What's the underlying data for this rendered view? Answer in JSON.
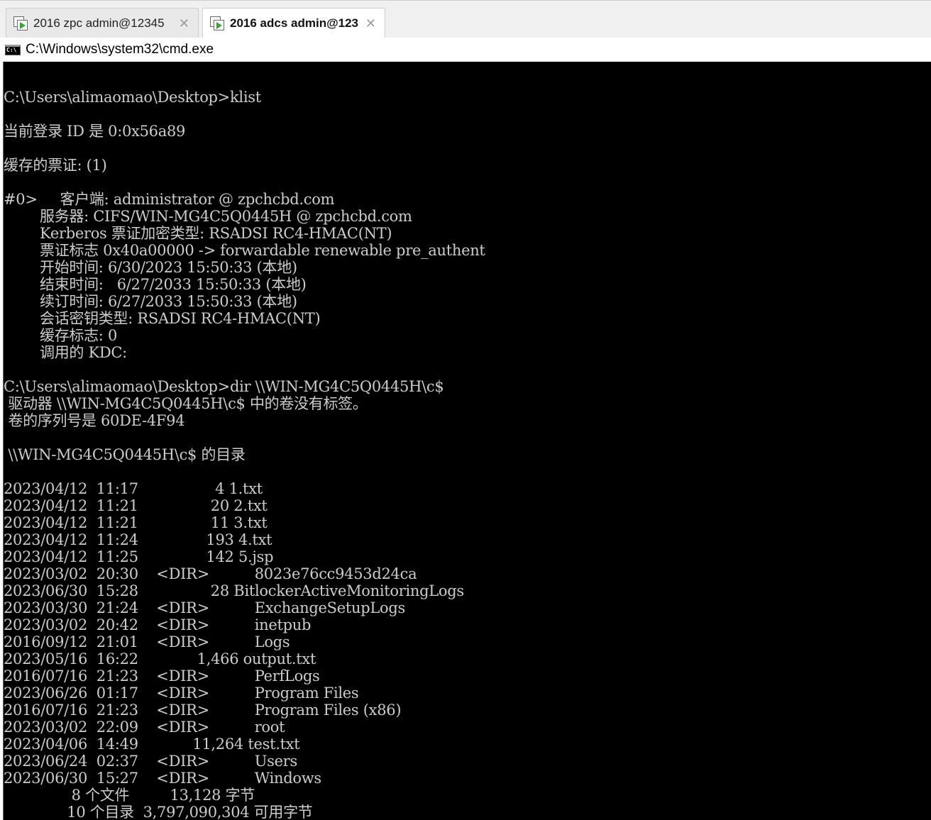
{
  "tabs": [
    {
      "label": "2016 zpc admin@12345",
      "close": "✕",
      "active": false
    },
    {
      "label": "2016 adcs admin@123",
      "close": "✕",
      "active": true
    }
  ],
  "window": {
    "icon_text": "C:\\",
    "title": "C:\\Windows\\system32\\cmd.exe"
  },
  "console": {
    "lines": [
      "",
      "C:\\Users\\alimaomao\\Desktop>klist",
      "",
      "当前登录 ID 是 0:0x56a89",
      "",
      "缓存的票证: (1)",
      "",
      "#0>     客户端: administrator @ zpchcbd.com",
      "        服务器: CIFS/WIN-MG4C5Q0445H @ zpchcbd.com",
      "        Kerberos 票证加密类型: RSADSI RC4-HMAC(NT)",
      "        票证标志 0x40a00000 -> forwardable renewable pre_authent",
      "        开始时间: 6/30/2023 15:50:33 (本地)",
      "        结束时间:   6/27/2033 15:50:33 (本地)",
      "        续订时间: 6/27/2033 15:50:33 (本地)",
      "        会话密钥类型: RSADSI RC4-HMAC(NT)",
      "        缓存标志: 0",
      "        调用的 KDC:",
      "",
      "C:\\Users\\alimaomao\\Desktop>dir \\\\WIN-MG4C5Q0445H\\c$",
      " 驱动器 \\\\WIN-MG4C5Q0445H\\c$ 中的卷没有标签。",
      " 卷的序列号是 60DE-4F94",
      "",
      " \\\\WIN-MG4C5Q0445H\\c$ 的目录",
      "",
      "2023/04/12  11:17                 4 1.txt",
      "2023/04/12  11:21                20 2.txt",
      "2023/04/12  11:21                11 3.txt",
      "2023/04/12  11:24               193 4.txt",
      "2023/04/12  11:25               142 5.jsp",
      "2023/03/02  20:30    <DIR>          8023e76cc9453d24ca",
      "2023/06/30  15:28                28 BitlockerActiveMonitoringLogs",
      "2023/03/30  21:24    <DIR>          ExchangeSetupLogs",
      "2023/03/02  20:42    <DIR>          inetpub",
      "2016/09/12  21:01    <DIR>          Logs",
      "2023/05/16  16:22             1,466 output.txt",
      "2016/07/16  21:23    <DIR>          PerfLogs",
      "2023/06/26  01:17    <DIR>          Program Files",
      "2016/07/16  21:23    <DIR>          Program Files (x86)",
      "2023/03/02  22:09    <DIR>          root",
      "2023/04/06  14:49            11,264 test.txt",
      "2023/06/24  02:37    <DIR>          Users",
      "2023/06/30  15:27    <DIR>          Windows",
      "               8 个文件         13,128 字节",
      "              10 个目录  3,797,090,304 可用字节"
    ]
  }
}
